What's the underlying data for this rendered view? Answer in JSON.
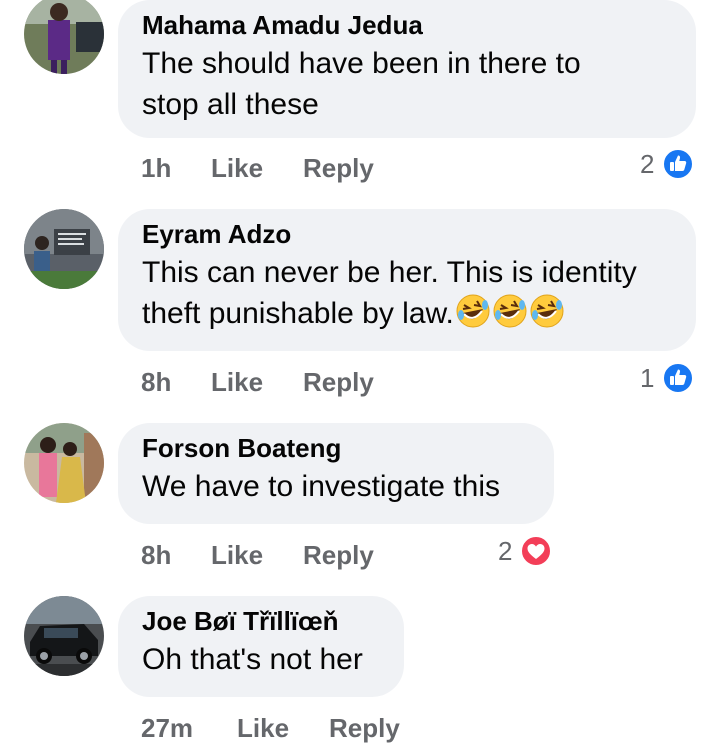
{
  "comments": [
    {
      "author": "Mahama Amadu Jedua",
      "text_lines": [
        "The should have been in there to",
        "stop all these"
      ],
      "time": "1h",
      "like_label": "Like",
      "reply_label": "Reply",
      "reaction_count": "2",
      "reaction_type": "like-icon"
    },
    {
      "author": "Eyram Adzo",
      "text_lines": [
        "This can never be her. This is identity",
        "theft punishable by law."
      ],
      "emoji_names": [
        "rolling-laughing-emoji",
        "rolling-laughing-emoji",
        "rolling-laughing-emoji"
      ],
      "time": "8h",
      "like_label": "Like",
      "reply_label": "Reply",
      "reaction_count": "1",
      "reaction_type": "like-icon"
    },
    {
      "author": "Forson Boateng",
      "text_lines": [
        "We have to investigate this"
      ],
      "time": "8h",
      "like_label": "Like",
      "reply_label": "Reply",
      "reaction_count": "2",
      "reaction_type": "love-icon"
    },
    {
      "author": "Joe Bøï Třïllïœň",
      "text_lines": [
        "Oh that's not her"
      ],
      "time": "27m",
      "like_label": "Like",
      "reply_label": "Reply"
    }
  ],
  "colors": {
    "bubble_bg": "#f0f2f5",
    "meta_text": "#65676b",
    "like_blue": "#1877f2",
    "love_red": "#f33e58"
  }
}
